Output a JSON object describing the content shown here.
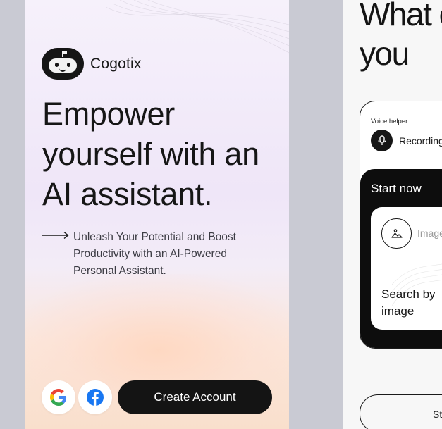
{
  "onboarding": {
    "brand_name": "Cogotix",
    "headline": "Empower yourself with an AI assistant.",
    "subtitle": "Unleash Your Potential and Boost Productivity with an AI-Powered Personal Assistant.",
    "social_buttons": [
      {
        "icon": "google-icon",
        "brand_colors": [
          "#4285F4",
          "#EA4335",
          "#FBBC05",
          "#34A853"
        ]
      },
      {
        "icon": "facebook-icon",
        "brand_color": "#1877F2"
      }
    ],
    "create_account_label": "Create Account"
  },
  "features": {
    "title": "What c for you",
    "voice_helper_label": "Voice helper",
    "recording_label": "Recording",
    "start_now_label": "Start now",
    "image_label": "Image",
    "search_by_image_label": "Search by image",
    "bottom_button_label": "St"
  },
  "colors": {
    "background": "#c9cad3",
    "dark": "#141414",
    "text": "#161616",
    "muted_text": "#3c3c44",
    "gradient_top": "#f6f1fb",
    "gradient_bottom": "#f9dfcc"
  }
}
